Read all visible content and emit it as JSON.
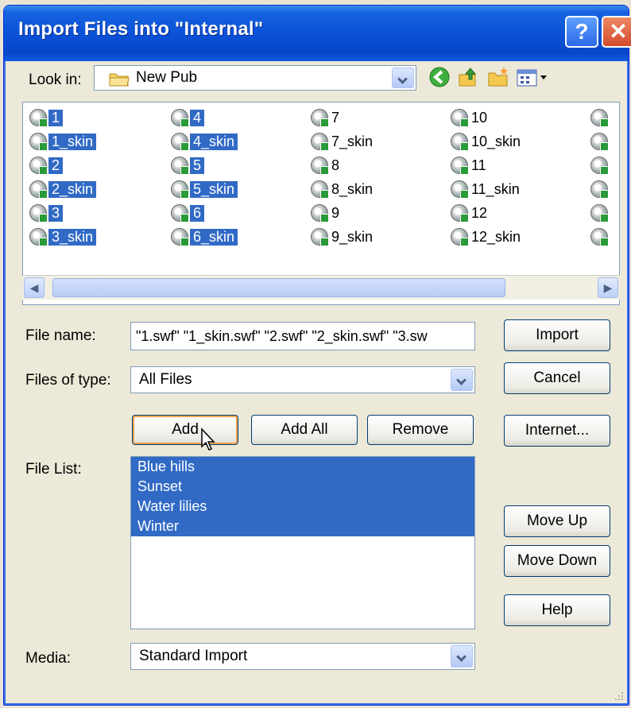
{
  "window": {
    "title": "Import Files into \"Internal\"",
    "help_glyph": "?",
    "close_glyph": "✕"
  },
  "look_in": {
    "label": "Look in:",
    "value": "New Pub"
  },
  "toolbar_icons": [
    "back-icon",
    "up-folder-icon",
    "new-folder-icon",
    "view-menu-icon"
  ],
  "files": [
    {
      "name": "1",
      "selected": true
    },
    {
      "name": "1_skin",
      "selected": true
    },
    {
      "name": "2",
      "selected": true
    },
    {
      "name": "2_skin",
      "selected": true
    },
    {
      "name": "3",
      "selected": true
    },
    {
      "name": "3_skin",
      "selected": true
    },
    {
      "name": "4",
      "selected": true
    },
    {
      "name": "4_skin",
      "selected": true
    },
    {
      "name": "5",
      "selected": true
    },
    {
      "name": "5_skin",
      "selected": true
    },
    {
      "name": "6",
      "selected": true
    },
    {
      "name": "6_skin",
      "selected": true
    },
    {
      "name": "7",
      "selected": false
    },
    {
      "name": "7_skin",
      "selected": false
    },
    {
      "name": "8",
      "selected": false
    },
    {
      "name": "8_skin",
      "selected": false
    },
    {
      "name": "9",
      "selected": false
    },
    {
      "name": "9_skin",
      "selected": false
    },
    {
      "name": "10",
      "selected": false
    },
    {
      "name": "10_skin",
      "selected": false
    },
    {
      "name": "11",
      "selected": false
    },
    {
      "name": "11_skin",
      "selected": false
    },
    {
      "name": "12",
      "selected": false
    },
    {
      "name": "12_skin",
      "selected": false
    }
  ],
  "file_name": {
    "label": "File name:",
    "value": "\"1.swf\" \"1_skin.swf\" \"2.swf\" \"2_skin.swf\" \"3.sw"
  },
  "files_of_type": {
    "label": "Files of type:",
    "value": "All Files"
  },
  "buttons": {
    "import": "Import",
    "cancel": "Cancel",
    "internet": "Internet...",
    "add": "Add",
    "add_all": "Add All",
    "remove": "Remove",
    "move_up": "Move Up",
    "move_down": "Move Down",
    "help": "Help"
  },
  "file_list": {
    "label": "File List:",
    "items": [
      "Blue hills",
      "Sunset",
      "Water lilies",
      "Winter"
    ]
  },
  "media": {
    "label": "Media:",
    "value": "Standard Import"
  },
  "colors": {
    "selection": "#316ac5",
    "titlebar": "#0a52d8",
    "dialog_bg": "#ece9d8"
  }
}
